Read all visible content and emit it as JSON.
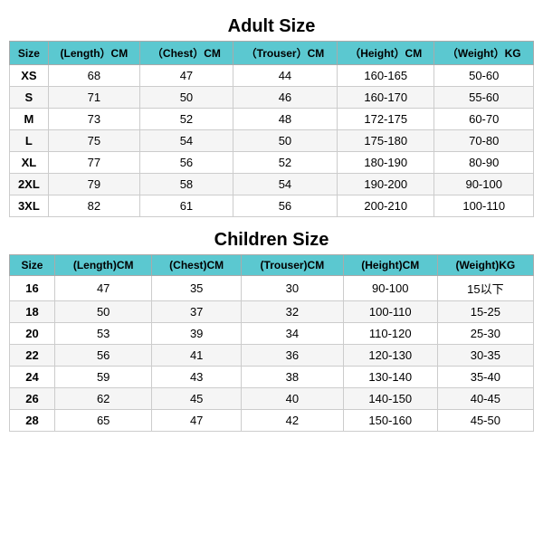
{
  "adult": {
    "title": "Adult Size",
    "headers": [
      "Size",
      "(Length）CM",
      "（Chest）CM",
      "（Trouser）CM",
      "（Height）CM",
      "（Weight）KG"
    ],
    "rows": [
      [
        "XS",
        "68",
        "47",
        "44",
        "160-165",
        "50-60"
      ],
      [
        "S",
        "71",
        "50",
        "46",
        "160-170",
        "55-60"
      ],
      [
        "M",
        "73",
        "52",
        "48",
        "172-175",
        "60-70"
      ],
      [
        "L",
        "75",
        "54",
        "50",
        "175-180",
        "70-80"
      ],
      [
        "XL",
        "77",
        "56",
        "52",
        "180-190",
        "80-90"
      ],
      [
        "2XL",
        "79",
        "58",
        "54",
        "190-200",
        "90-100"
      ],
      [
        "3XL",
        "82",
        "61",
        "56",
        "200-210",
        "100-110"
      ]
    ]
  },
  "children": {
    "title": "Children Size",
    "headers": [
      "Size",
      "(Length)CM",
      "(Chest)CM",
      "(Trouser)CM",
      "(Height)CM",
      "(Weight)KG"
    ],
    "rows": [
      [
        "16",
        "47",
        "35",
        "30",
        "90-100",
        "15以下"
      ],
      [
        "18",
        "50",
        "37",
        "32",
        "100-110",
        "15-25"
      ],
      [
        "20",
        "53",
        "39",
        "34",
        "110-120",
        "25-30"
      ],
      [
        "22",
        "56",
        "41",
        "36",
        "120-130",
        "30-35"
      ],
      [
        "24",
        "59",
        "43",
        "38",
        "130-140",
        "35-40"
      ],
      [
        "26",
        "62",
        "45",
        "40",
        "140-150",
        "40-45"
      ],
      [
        "28",
        "65",
        "47",
        "42",
        "150-160",
        "45-50"
      ]
    ]
  }
}
